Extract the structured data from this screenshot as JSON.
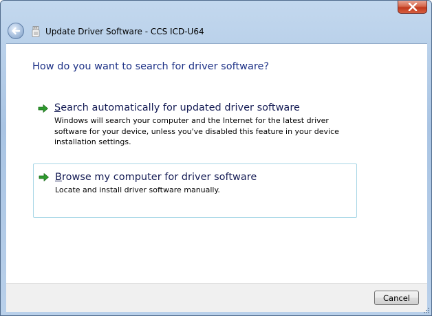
{
  "window": {
    "title": "Update Driver Software - CCS ICD-U64",
    "close_icon": "close-icon",
    "back_icon": "back-arrow-icon",
    "device_icon": "usb-device-icon"
  },
  "main": {
    "heading": "How do you want to search for driver software?",
    "options": [
      {
        "title_accel": "S",
        "title_rest": "earch automatically for updated driver software",
        "description": "Windows will search your computer and the Internet for the latest driver software for your device, unless you've disabled this feature in your device installation settings.",
        "icon": "green-arrow-icon"
      },
      {
        "title_accel": "B",
        "title_rest": "rowse my computer for driver software",
        "description": "Locate and install driver software manually.",
        "icon": "green-arrow-icon"
      }
    ]
  },
  "footer": {
    "cancel_label": "Cancel"
  },
  "colors": {
    "heading": "#1e3287",
    "option_title": "#151c55",
    "highlight_border": "#a6d6e6",
    "arrow_green": "#2e9a2e",
    "close_red": "#c0391e"
  }
}
